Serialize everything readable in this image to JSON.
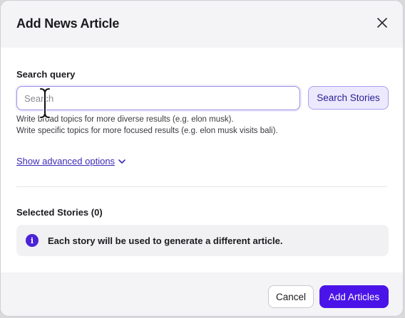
{
  "dialog": {
    "title": "Add News Article",
    "close_icon": "close-icon"
  },
  "search": {
    "label": "Search query",
    "placeholder": "Search",
    "value": "",
    "button_label": "Search Stories",
    "help_line1": "Write broad topics for more diverse results (e.g. elon musk).",
    "help_line2": "Write specific topics for more focused results (e.g. elon musk visits bali)."
  },
  "advanced": {
    "label": "Show advanced options",
    "icon": "chevron-down-icon"
  },
  "selected": {
    "label": "Selected Stories (0)",
    "info_icon": "info-icon",
    "info_text": "Each story will be used to generate a different article."
  },
  "footer": {
    "cancel_label": "Cancel",
    "add_label": "Add Articles"
  },
  "colors": {
    "accent": "#4a14e8",
    "accent_light": "#ece9ff",
    "header_bg": "#f4f4f6"
  }
}
